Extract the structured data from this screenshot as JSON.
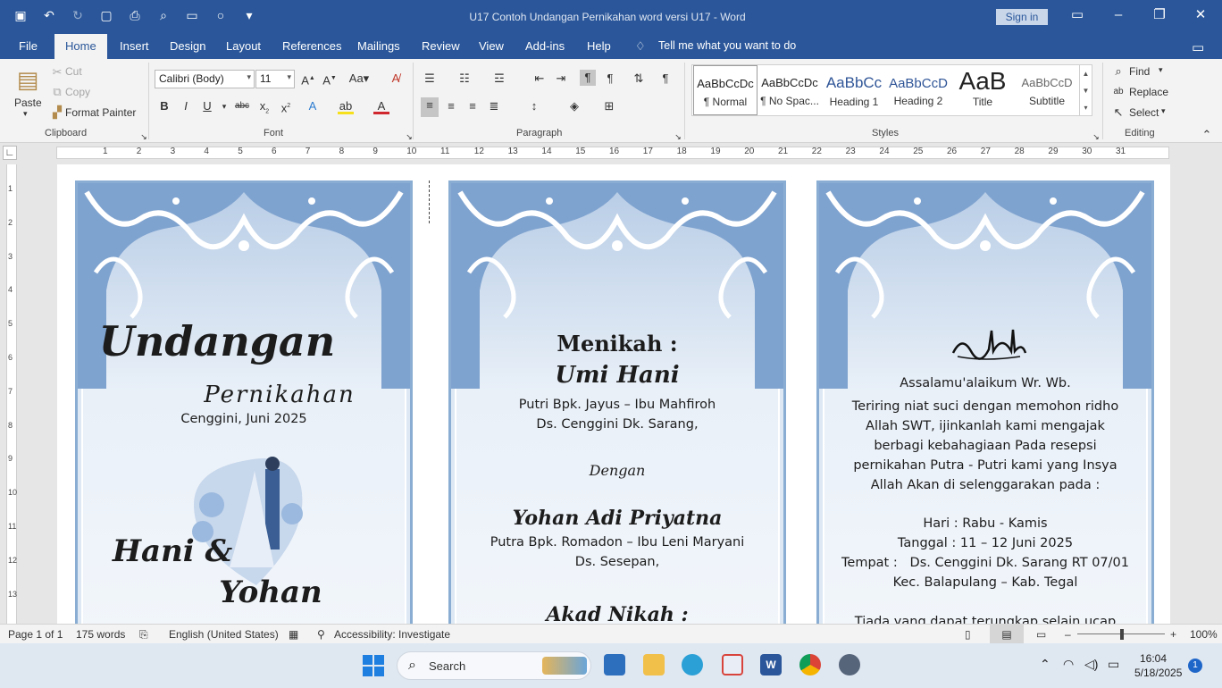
{
  "window": {
    "title": "U17 Contoh Undangan Pernikahan word versi U17  -  Word",
    "sign_in": "Sign in"
  },
  "tabs": [
    "File",
    "Home",
    "Insert",
    "Design",
    "Layout",
    "References",
    "Mailings",
    "Review",
    "View",
    "Add-ins",
    "Help"
  ],
  "tell_me": "Tell me what you want to do",
  "clipboard": {
    "paste": "Paste",
    "cut": "Cut",
    "copy": "Copy",
    "format_painter": "Format Painter",
    "label": "Clipboard"
  },
  "font": {
    "name": "Calibri (Body)",
    "size": "11",
    "label": "Font"
  },
  "paragraph": {
    "label": "Paragraph"
  },
  "styles": {
    "label": "Styles",
    "items": [
      {
        "sample": "AaBbCcDc",
        "name": "¶ Normal"
      },
      {
        "sample": "AaBbCcDc",
        "name": "¶ No Spac..."
      },
      {
        "sample": "AaBbCc",
        "name": "Heading 1"
      },
      {
        "sample": "AaBbCcD",
        "name": "Heading 2"
      },
      {
        "sample": "AaB",
        "name": "Title"
      },
      {
        "sample": "AaBbCcD",
        "name": "Subtitle"
      }
    ]
  },
  "editing": {
    "find": "Find",
    "replace": "Replace",
    "select": "Select",
    "label": "Editing"
  },
  "ruler": {
    "marks": [
      "1",
      "2",
      "3",
      "4",
      "5",
      "6",
      "7",
      "8",
      "9",
      "10",
      "11",
      "12",
      "13",
      "14",
      "15",
      "16",
      "17",
      "18",
      "19",
      "20",
      "21",
      "22",
      "23",
      "24",
      "25",
      "26",
      "27",
      "28",
      "29",
      "30",
      "31"
    ],
    "vmarks": [
      "1",
      "2",
      "3",
      "4",
      "5",
      "6",
      "7",
      "8",
      "9",
      "10",
      "11",
      "12",
      "13"
    ]
  },
  "card1": {
    "title": "Undangan",
    "subtitle": "Pernikahan",
    "date": "Cenggini, Juni 2025",
    "name1": "Hani &",
    "name2": "Yohan"
  },
  "card2": {
    "heading": "Menikah :",
    "bride": "Umi Hani",
    "bride_parents": "Putri Bpk. Jayus – Ibu Mahfiroh",
    "bride_addr": "Ds. Cenggini Dk. Sarang,",
    "with": "Dengan",
    "groom": "Yohan Adi Priyatna",
    "groom_parents": "Putra Bpk. Romadon – Ibu Leni Maryani",
    "groom_addr": "Ds. Sesepan,",
    "akad": "Akad Nikah :"
  },
  "card3": {
    "greeting": "Assalamu'alaikum Wr. Wb.",
    "body": [
      "Teriring niat suci dengan memohon ridho",
      "Allah SWT, ijinkanlah kami mengajak",
      "berbagi kebahagiaan Pada resepsi",
      "pernikahan Putra - Putri kami yang Insya",
      "Allah Akan di selenggarakan pada :"
    ],
    "day": "Hari : Rabu - Kamis",
    "date": "Tanggal : 11 – 12 Juni 2025",
    "place": "Tempat :   Ds. Cenggini Dk. Sarang RT 07/01",
    "district": "Kec. Balapulang – Kab. Tegal",
    "closing": "Tiada yang dapat terungkap selain ucap"
  },
  "status": {
    "page": "Page 1 of 1",
    "words": "175 words",
    "language": "English (United States)",
    "accessibility": "Accessibility: Investigate",
    "zoom": "100%"
  },
  "taskbar": {
    "search": "Search",
    "time": "16:04",
    "date": "5/18/2025",
    "badge": "1"
  },
  "colors": {
    "accent": "#2b579a",
    "card_border": "#8aaed3"
  }
}
